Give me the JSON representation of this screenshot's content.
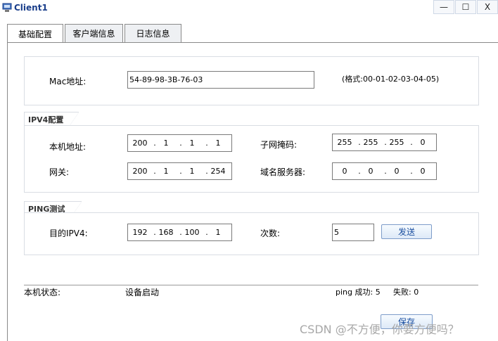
{
  "window": {
    "title": "Client1",
    "minimize_glyph": "—",
    "maximize_glyph": "☐",
    "close_glyph": "X"
  },
  "tabs": [
    {
      "label": "基础配置",
      "active": true
    },
    {
      "label": "客户端信息",
      "active": false
    },
    {
      "label": "日志信息",
      "active": false
    }
  ],
  "mac": {
    "label": "Mac地址:",
    "value": "54-89-98-3B-76-03",
    "format_hint": "(格式:00-01-02-03-04-05)"
  },
  "ipv4": {
    "group_title": "IPV4配置",
    "local_ip": {
      "label": "本机地址:",
      "octets": [
        "200",
        "1",
        "1",
        "1"
      ]
    },
    "subnet_mask": {
      "label": "子网掩码:",
      "octets": [
        "255",
        "255",
        "255",
        "0"
      ]
    },
    "gateway": {
      "label": "网关:",
      "octets": [
        "200",
        "1",
        "1",
        "254"
      ]
    },
    "dns": {
      "label": "域名服务器:",
      "octets": [
        "0",
        "0",
        "0",
        "0"
      ]
    }
  },
  "ping": {
    "group_title": "PING测试",
    "dest_label": "目的IPV4:",
    "dest_octets": [
      "192",
      "168",
      "100",
      "1"
    ],
    "count_label": "次数:",
    "count_value": "5",
    "send_label": "发送"
  },
  "status": {
    "label": "本机状态:",
    "value": "设备启动",
    "ping_success": "ping 成功: 5",
    "ping_fail": "失败: 0"
  },
  "save_label": "保存",
  "watermark": "CSDN @不方便，你要方便吗？",
  "colors": {
    "title": "#1b3f8b",
    "button_text": "#1b4fa0",
    "panel_border": "#d9dde3"
  }
}
